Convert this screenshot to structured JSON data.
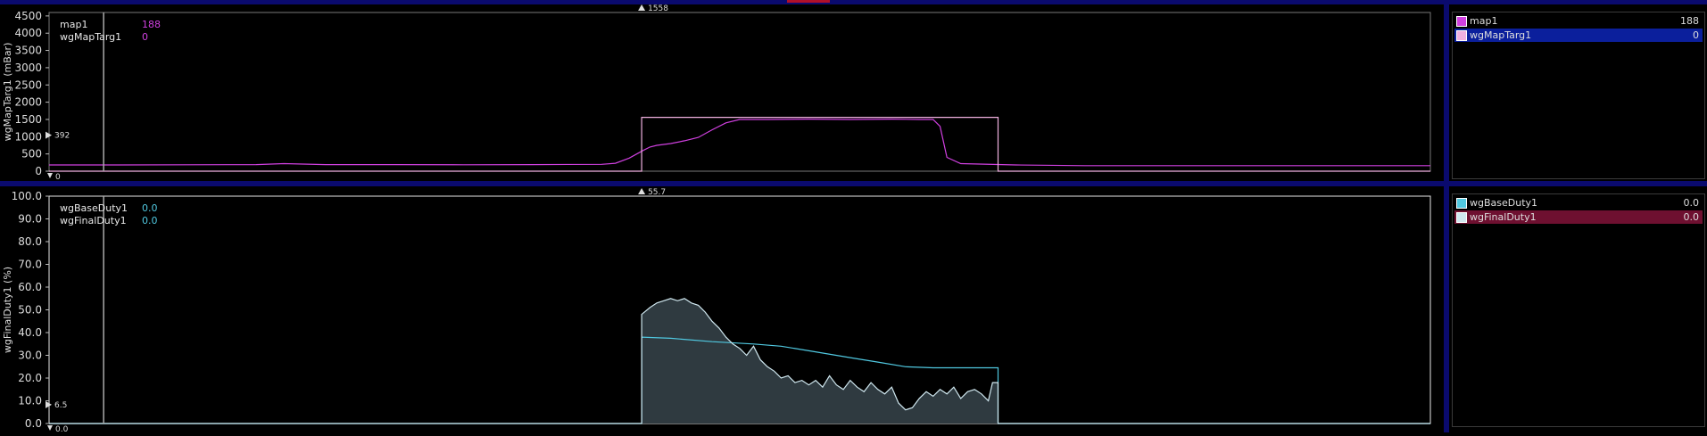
{
  "colors": {
    "map1": "#d040e0",
    "wgMapTarg1": "#f0b0e0",
    "wgBaseDuty1": "#50c8e0",
    "wgFinalDuty1": "#d0e8f0",
    "accent_blue": "#0b1f9c",
    "accent_red": "#6e1030"
  },
  "top": {
    "cursor_marker": "1558",
    "ref_marker": "392",
    "zero_marker": "0",
    "readout": [
      {
        "name": "map1",
        "value": "188"
      },
      {
        "name": "wgMapTarg1",
        "value": "0"
      }
    ],
    "legend": [
      {
        "name": "map1",
        "value": "188"
      },
      {
        "name": "wgMapTarg1",
        "value": "0"
      }
    ]
  },
  "bottom": {
    "cursor_marker": "55.7",
    "ref_marker": "6.5",
    "zero_marker": "0.0",
    "readout": [
      {
        "name": "wgBaseDuty1",
        "value": "0.0"
      },
      {
        "name": "wgFinalDuty1",
        "value": "0.0"
      }
    ],
    "legend": [
      {
        "name": "wgBaseDuty1",
        "value": "0.0"
      },
      {
        "name": "wgFinalDuty1",
        "value": "0.0"
      }
    ]
  },
  "chart_data": [
    {
      "type": "line",
      "ylabel": "wgMapTarg1 (mBar)",
      "ylim": [
        0,
        4600
      ],
      "yticks": [
        "0",
        "500",
        "1000",
        "1500",
        "2000",
        "2500",
        "3000",
        "3500",
        "4000",
        "4500"
      ],
      "xlim": [
        0,
        100
      ],
      "series": [
        {
          "name": "map1",
          "x": [
            0,
            5,
            10,
            15,
            17,
            20,
            25,
            30,
            35,
            40,
            41,
            42,
            43,
            43.5,
            44,
            45,
            46,
            47,
            48,
            49,
            50,
            52,
            55,
            58,
            61,
            63,
            64,
            64.5,
            65,
            66,
            70,
            75,
            80,
            90,
            100
          ],
          "values": [
            180,
            180,
            185,
            190,
            220,
            190,
            190,
            185,
            190,
            200,
            230,
            380,
            600,
            700,
            750,
            800,
            880,
            980,
            1200,
            1400,
            1500,
            1500,
            1510,
            1500,
            1510,
            1500,
            1500,
            1300,
            400,
            220,
            180,
            160,
            160,
            160,
            160
          ]
        },
        {
          "name": "wgMapTarg1",
          "x": [
            0,
            42.9,
            42.9,
            68.7,
            68.7,
            100
          ],
          "values": [
            0,
            0,
            1560,
            1560,
            0,
            0
          ]
        }
      ]
    },
    {
      "type": "area",
      "ylabel": "wgFinalDuty1 (%)",
      "ylim": [
        0,
        100
      ],
      "yticks": [
        "0.0",
        "10.0",
        "20.0",
        "30.0",
        "40.0",
        "50.0",
        "60.0",
        "70.0",
        "80.0",
        "90.0",
        "100.0"
      ],
      "xlim": [
        0,
        100
      ],
      "series": [
        {
          "name": "wgBaseDuty1",
          "x": [
            0,
            42.9,
            42.9,
            45,
            48,
            51,
            53,
            55,
            58,
            60,
            62,
            64,
            68.7,
            68.7,
            100
          ],
          "values": [
            0,
            0,
            38,
            37.5,
            36,
            35,
            34,
            32,
            29,
            27,
            25,
            24.5,
            24.5,
            0,
            0
          ]
        },
        {
          "name": "wgFinalDuty1",
          "x": [
            0,
            42.9,
            42.9,
            43.5,
            44,
            44.5,
            45,
            45.5,
            46,
            46.5,
            47,
            47.5,
            48,
            48.5,
            49,
            49.5,
            50,
            50.5,
            51,
            51.5,
            52,
            52.5,
            53,
            53.5,
            54,
            54.5,
            55,
            55.5,
            56,
            56.5,
            57,
            57.5,
            58,
            58.5,
            59,
            59.5,
            60,
            60.5,
            61,
            61.5,
            62,
            62.5,
            63,
            63.5,
            64,
            64.5,
            65,
            65.5,
            66,
            66.5,
            67,
            67.5,
            68,
            68.3,
            68.7,
            68.7,
            100
          ],
          "values": [
            0,
            0,
            48,
            51,
            53,
            54,
            55,
            54,
            55,
            53,
            52,
            49,
            45,
            42,
            38,
            35,
            33,
            30,
            34,
            28,
            25,
            23,
            20,
            21,
            18,
            19,
            17,
            19,
            16,
            21,
            17,
            15,
            19,
            16,
            14,
            18,
            15,
            13,
            16,
            9,
            6,
            7,
            11,
            14,
            12,
            15,
            13,
            16,
            11,
            14,
            15,
            13,
            10,
            18,
            18,
            0,
            0
          ]
        }
      ]
    }
  ]
}
